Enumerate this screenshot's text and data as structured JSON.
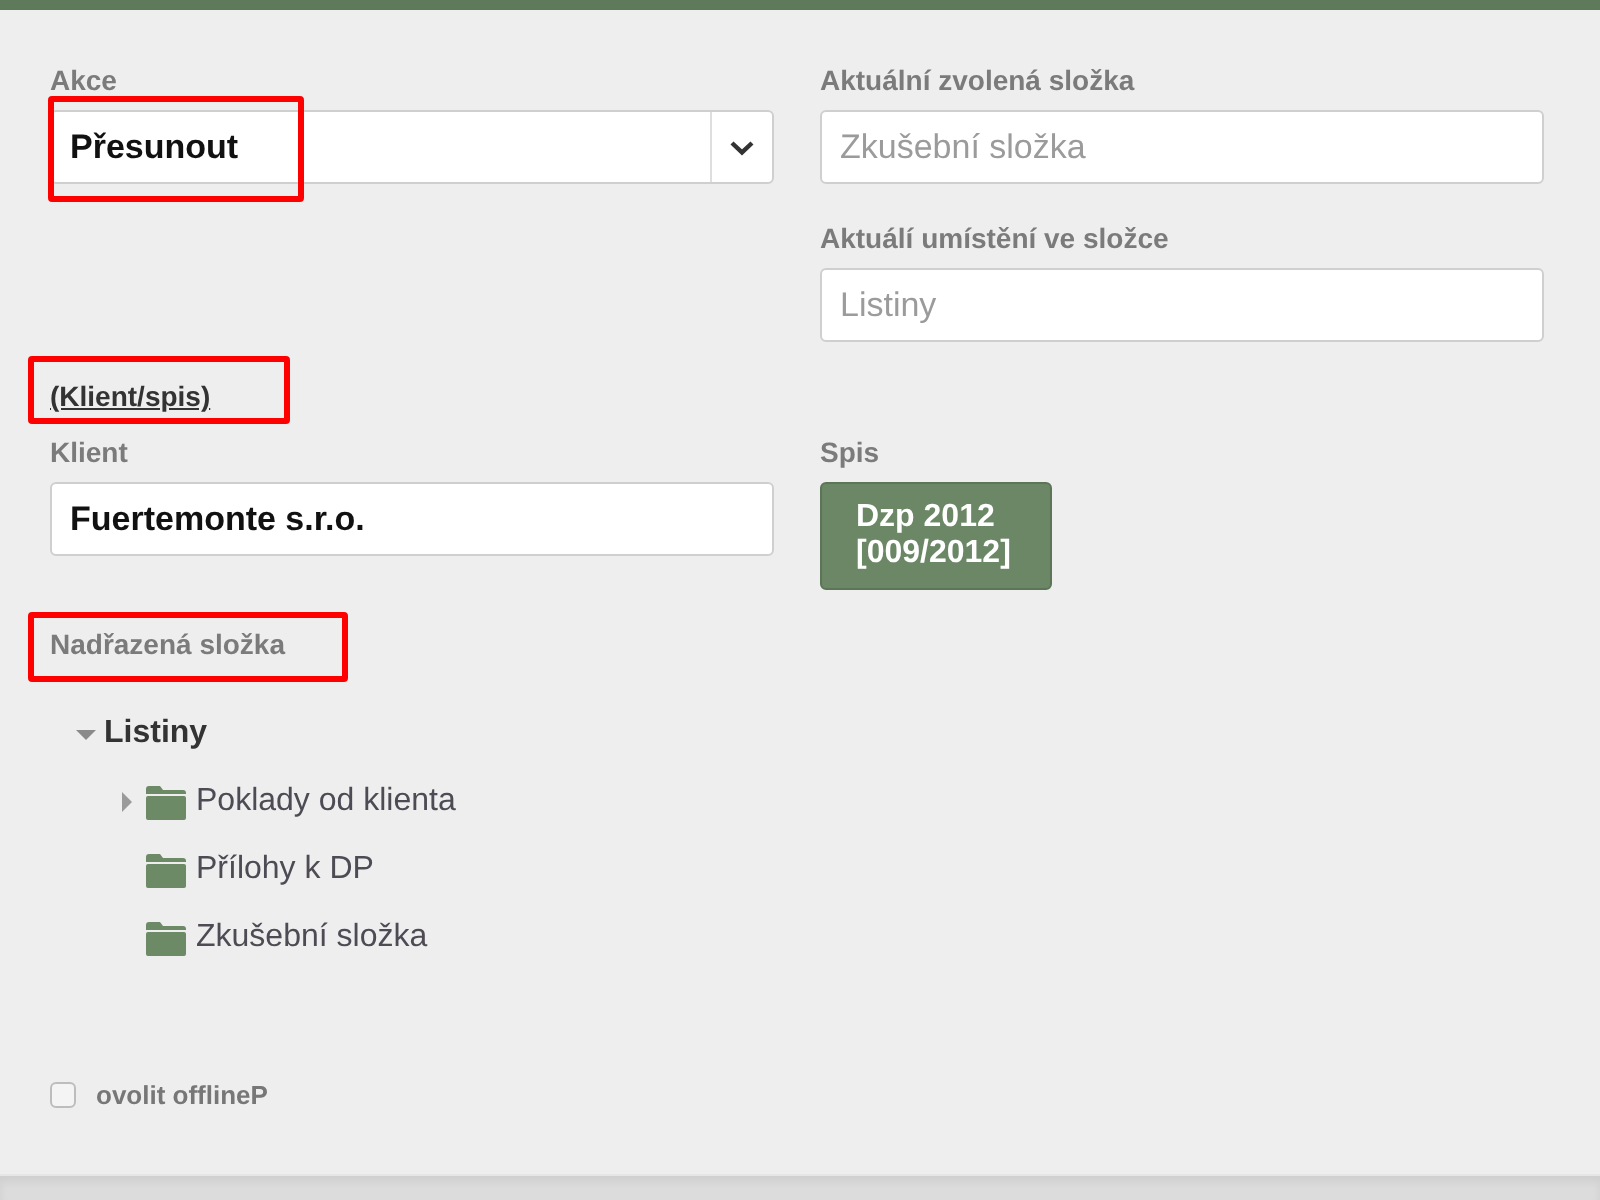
{
  "action": {
    "label": "Akce",
    "value": "Přesunout",
    "highlighted": true
  },
  "current_folder": {
    "label": "Aktuální zvolená složka",
    "placeholder": "Zkušební složka"
  },
  "current_location": {
    "label": "Aktuálí umístění ve složce",
    "placeholder": "Listiny"
  },
  "client_file_link": {
    "text": "(Klient/spis)",
    "highlighted": true
  },
  "client": {
    "label": "Klient",
    "value": "Fuertemonte s.r.o."
  },
  "file": {
    "label": "Spis",
    "button": "Dzp 2012 [009/2012]"
  },
  "parent_folder": {
    "label": "Nadřazená složka",
    "highlighted": true
  },
  "tree": [
    {
      "label": "Listiny",
      "expanded": true,
      "children": [
        {
          "label": "Poklady od klienta",
          "expanded": false
        },
        {
          "label": "Přílohy k DP"
        },
        {
          "label": "Zkušební složka"
        }
      ]
    }
  ],
  "offline": {
    "label": "ovolit offlineP",
    "checked": false
  }
}
